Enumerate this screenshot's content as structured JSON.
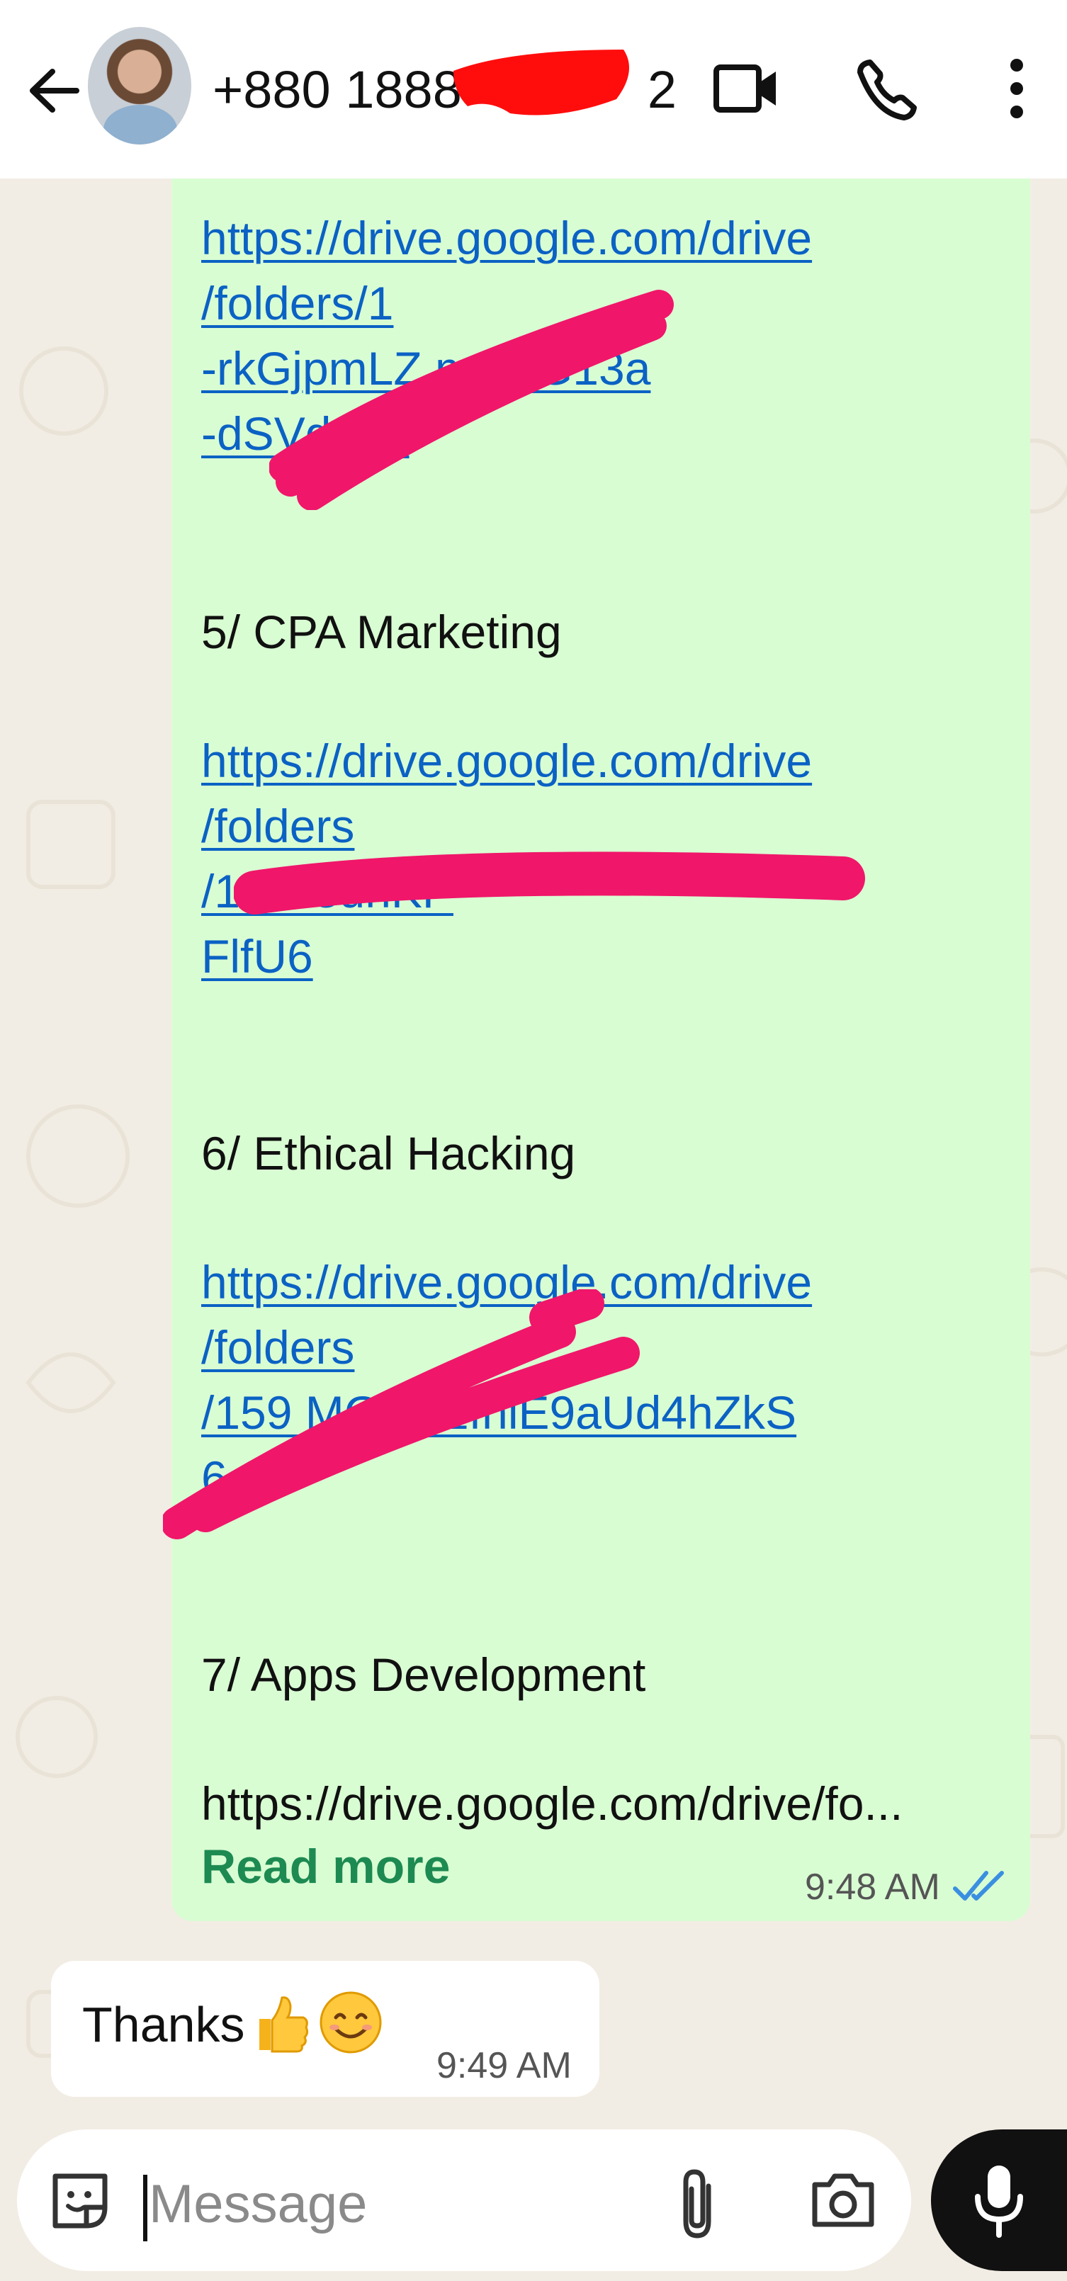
{
  "header": {
    "back_icon": "arrow-left-icon",
    "contact_number": "+880 1888",
    "contact_suffix": "2",
    "video_icon": "video-call-icon",
    "call_icon": "phone-icon",
    "menu_icon": "more-vertical-icon"
  },
  "outgoing_message": {
    "lines": [
      {
        "text": "https://drive.google.com/drive",
        "link": true
      },
      {
        "text": "/folders/1",
        "link": true
      },
      {
        "text": "-rkGjpmLZ        mmJG13a",
        "link": true
      },
      {
        "text": "-dSVd      Ma",
        "link": true
      },
      {
        "text": "5/ CPA Marketing",
        "link": false
      },
      {
        "text": "https://drive.google.com/drive",
        "link": true
      },
      {
        "text": "/folders",
        "link": true
      },
      {
        "text": "/1AA                                   8uhKP",
        "link": true
      },
      {
        "text": "FlfU6",
        "link": true
      },
      {
        "text": "6/ Ethical Hacking",
        "link": false
      },
      {
        "text": "https://drive.google.com/drive",
        "link": true
      },
      {
        "text": "/folders",
        "link": true
      },
      {
        "text": "/159          MGmozfhlE9aUd4hZkS",
        "link": true
      },
      {
        "text": "         6",
        "link": true
      },
      {
        "text": "7/ Apps Development",
        "link": false
      },
      {
        "text": "https://drive.google.com/drive/fo...",
        "link": false
      }
    ],
    "read_more": "Read more",
    "time": "9:48 AM",
    "status": "read"
  },
  "incoming_message": {
    "text": "Thanks",
    "emojis": [
      "thumbs-up-emoji",
      "smiling-face-emoji"
    ],
    "time": "9:49 AM"
  },
  "composer": {
    "placeholder": "Message",
    "sticker_icon": "sticker-icon",
    "attach_icon": "paperclip-icon",
    "camera_icon": "camera-icon",
    "mic_icon": "microphone-icon"
  },
  "colors": {
    "outgoing_bubble": "#d9fdd3",
    "link": "#0b62c4",
    "read_more": "#1d8a52",
    "redaction_pink": "#f0166a",
    "redaction_red": "#ff0d0d",
    "read_ticks": "#3a8fe0"
  }
}
